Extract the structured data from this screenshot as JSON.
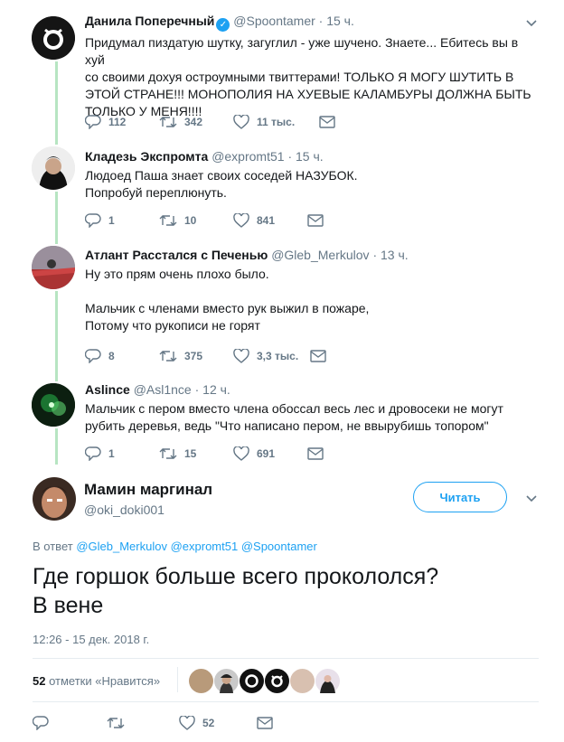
{
  "thread": [
    {
      "name": "Данила Поперечный",
      "verified": true,
      "handle": "@Spoontamer",
      "time": "· 15 ч.",
      "text": "Придумал пиздатую шутку, загуглил - уже шучено. Знаете... Ебитесь вы в хуй\nсо своими дохуя остроумными твиттерами! ТОЛЬКО Я МОГУ ШУТИТЬ В\nЭТОЙ СТРАНЕ!!! МОНОПОЛИЯ НА ХУЕВЫЕ КАЛАМБУРЫ ДОЛЖНА БЫТЬ\nТОЛЬКО У МЕНЯ!!!!",
      "replies": "112",
      "retweets": "342",
      "likes": "11 тыс."
    },
    {
      "name": "Кладезь Экспромта",
      "handle": "@expromt51",
      "time": "· 15 ч.",
      "text": "Людоед Паша знает своих соседей НАЗУБОК.\nПопробуй переплюнуть.",
      "replies": "1",
      "retweets": "10",
      "likes": "841"
    },
    {
      "name": "Атлант Расстался с Печенью",
      "handle": "@Gleb_Merkulov",
      "time": "· 13 ч.",
      "text": "Ну это прям очень плохо было.\n\nМальчик с членами вместо рук выжил в пожаре,\nПотому что рукописи не горят",
      "replies": "8",
      "retweets": "375",
      "likes": "3,3 тыс."
    },
    {
      "name": "Aslince",
      "handle": "@Asl1nce",
      "time": "· 12 ч.",
      "text": "Мальчик с пером вместо члена обоссал весь лес и дровосеки не могут\nрубить деревья, ведь \"Что написано пером, не ввырубишь топором\"",
      "replies": "1",
      "retweets": "15",
      "likes": "691"
    }
  ],
  "main": {
    "name": "Мамин маргинал",
    "handle": "@oki_doki001",
    "follow_label": "Читать",
    "reply_prefix": "В ответ",
    "mentions": [
      "@Gleb_Merkulov",
      "@expromt51",
      "@Spoontamer"
    ],
    "text": "Где горшок больше всего прокололся?\nВ вене",
    "timestamp": "12:26 - 15 дек. 2018 г.",
    "likes_count": "52",
    "likes_label": "отметки «Нравится»",
    "like_count_action": "52"
  },
  "colors": {
    "accent": "#1da1f2",
    "thread_line": "#b7e5c2",
    "muted": "#657786",
    "text": "#14171a"
  },
  "icons": [
    "reply-icon",
    "retweet-icon",
    "like-icon",
    "message-icon",
    "chevron-down-icon",
    "verified-icon"
  ]
}
